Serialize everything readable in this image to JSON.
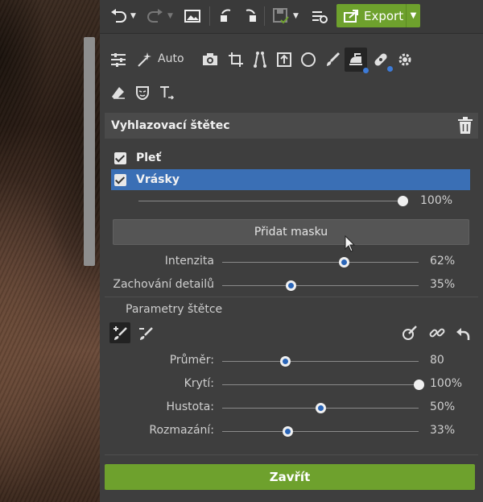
{
  "toolbar": {
    "export_label": "Export",
    "icons": [
      "undo-icon",
      "redo-icon",
      "image-icon",
      "compare-icon",
      "save-icon",
      "settings-icon",
      "export-icon"
    ]
  },
  "tools": {
    "auto_label": "Auto",
    "icons": [
      "adjustments-icon",
      "auto-wand-icon",
      "camera-icon",
      "crop-icon",
      "perspective-icon",
      "frame-icon",
      "circle-icon",
      "brush-icon",
      "smoothing-iron-icon",
      "bandage-icon",
      "gear-icon",
      "eraser-icon",
      "mask-face-icon",
      "text-icon"
    ]
  },
  "panel": {
    "title": "Vyhlazovací štětec",
    "options": [
      {
        "label": "Pleť",
        "checked": true,
        "selected": false
      },
      {
        "label": "Vrásky",
        "checked": true,
        "selected": true
      }
    ],
    "main_value": "100%",
    "main_level": 1.0,
    "add_mask_label": "Přidat masku",
    "sliders": [
      {
        "label": "Intenzita",
        "value": "62%",
        "level": 0.62
      },
      {
        "label": "Zachování detailů",
        "value": "35%",
        "level": 0.35
      }
    ],
    "brush_section_label": "Parametry štětce",
    "brush_sliders": [
      {
        "label": "Průměr:",
        "value": "80",
        "level": 0.32
      },
      {
        "label": "Krytí:",
        "value": "100%",
        "level": 1.0
      },
      {
        "label": "Hustota:",
        "value": "50%",
        "level": 0.5
      },
      {
        "label": "Rozmazání:",
        "value": "33%",
        "level": 0.33
      }
    ],
    "close_label": "Zavřít"
  },
  "colors": {
    "accent_green": "#6ea12d",
    "selection_blue": "#3a6fb5"
  }
}
